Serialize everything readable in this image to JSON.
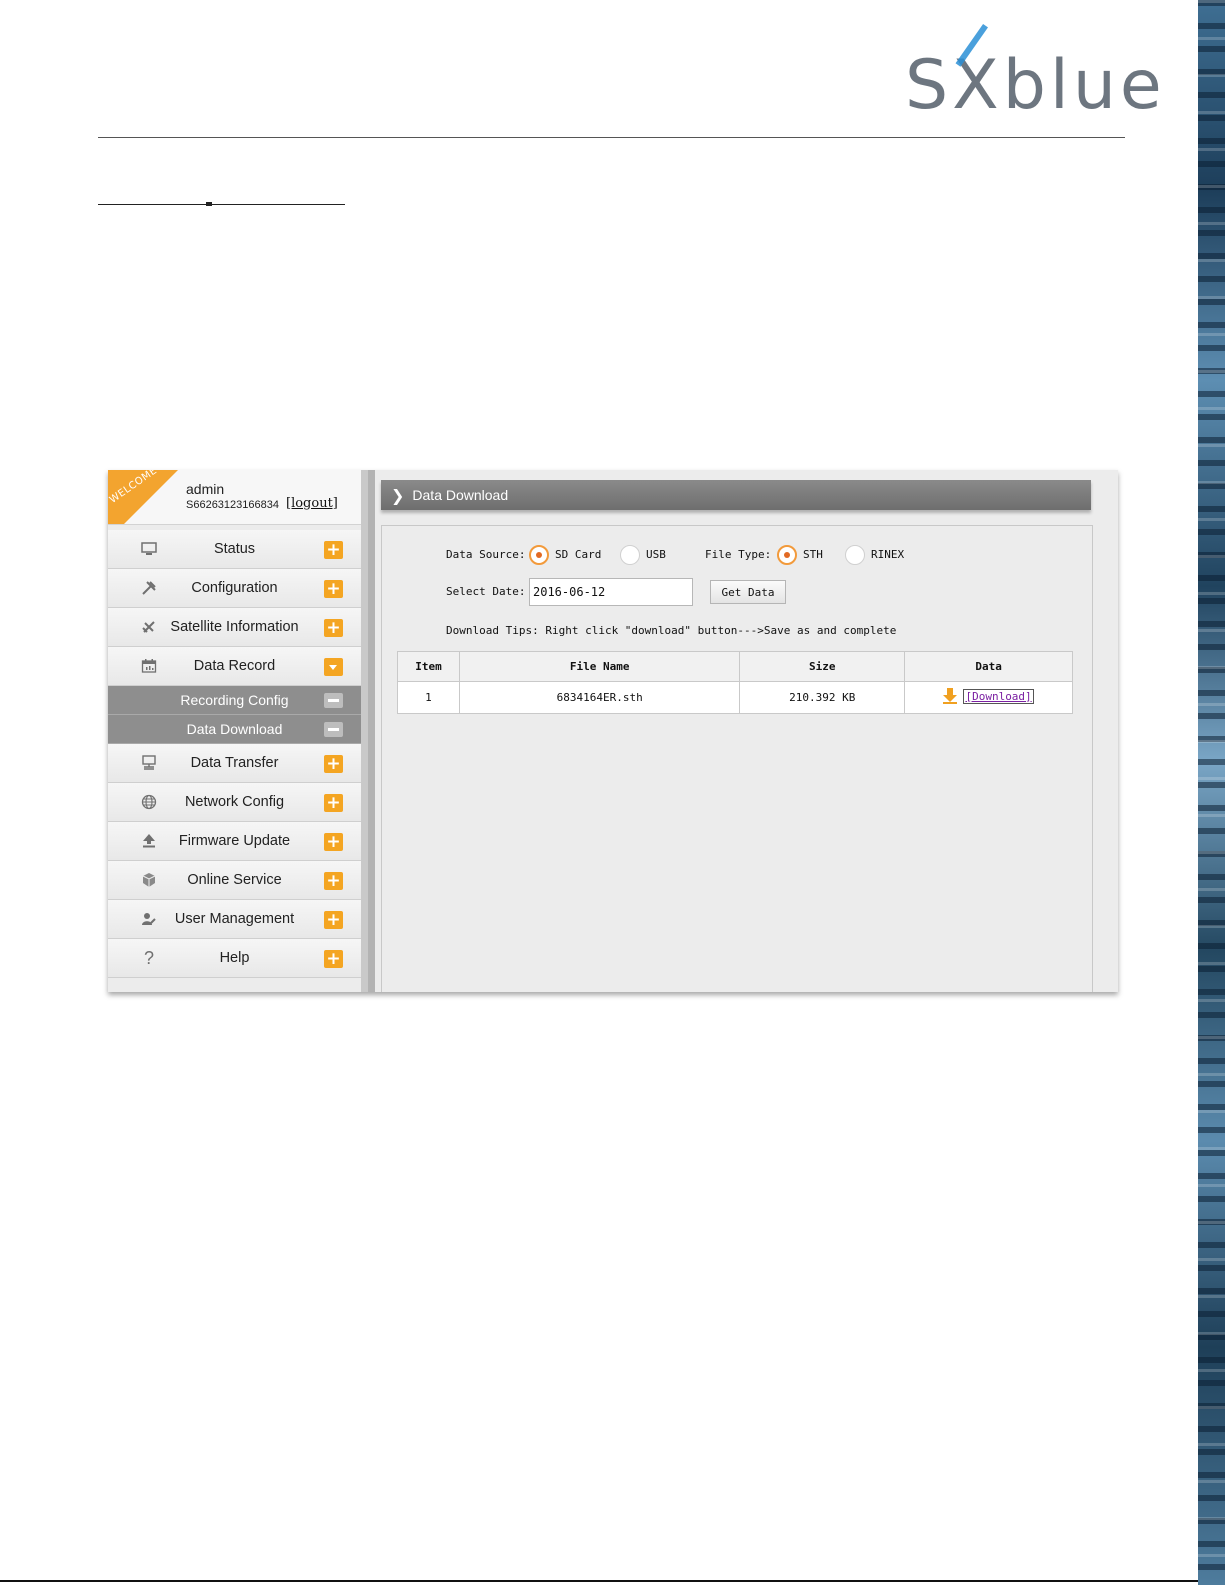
{
  "brand": {
    "logo_text_s": "S",
    "logo_text_x": "X",
    "logo_text_rest": "blue"
  },
  "user": {
    "name": "admin",
    "serial": "S66263123166834",
    "logout_label": "[logout]",
    "ribbon_text": "WELCOME"
  },
  "sidebar": {
    "items": [
      {
        "label": "Status",
        "icon": "monitor-icon"
      },
      {
        "label": "Configuration",
        "icon": "tools-icon"
      },
      {
        "label": "Satellite Information",
        "icon": "satellite-icon"
      },
      {
        "label": "Data Record",
        "icon": "calendar-icon",
        "expanded": true
      },
      {
        "label": "Data Transfer",
        "icon": "network-computer-icon"
      },
      {
        "label": "Network Config",
        "icon": "globe-icon"
      },
      {
        "label": "Firmware Update",
        "icon": "upload-icon"
      },
      {
        "label": "Online Service",
        "icon": "cube-icon"
      },
      {
        "label": "User Management",
        "icon": "user-edit-icon"
      },
      {
        "label": "Help",
        "icon": "question-icon"
      }
    ],
    "subitems": [
      {
        "label": "Recording Config"
      },
      {
        "label": "Data Download"
      }
    ]
  },
  "main": {
    "title": "Data Download",
    "form": {
      "data_source_label": "Data Source:",
      "data_source_options": [
        "SD Card",
        "USB"
      ],
      "data_source_selected": "SD Card",
      "file_type_label": "File Type:",
      "file_type_options": [
        "STH",
        "RINEX"
      ],
      "file_type_selected": "STH",
      "select_date_label": "Select Date:",
      "select_date_value": "2016-06-12",
      "get_data_label": "Get Data",
      "tips": "Download Tips: Right click \"download\" button--->Save as and complete"
    },
    "table": {
      "headers": [
        "Item",
        "File Name",
        "Size",
        "Data"
      ],
      "rows": [
        {
          "item": "1",
          "file_name": "6834164ER.sth",
          "size": "210.392 KB",
          "data": "[Download]"
        }
      ]
    }
  }
}
